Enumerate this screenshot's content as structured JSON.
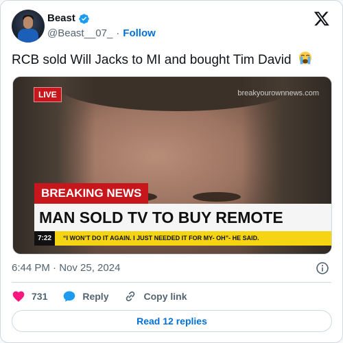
{
  "author": {
    "display_name": "Beast",
    "handle": "@Beast__07_",
    "separator": "·",
    "follow_label": "Follow",
    "verified": true
  },
  "tweet": {
    "text": "RCB sold Will Jacks to MI and bought Tim David",
    "emoji": "loudly-crying-face"
  },
  "media": {
    "live_label": "LIVE",
    "watermark": "breakyourownnews.com",
    "breaking_label": "BREAKING NEWS",
    "headline": "MAN SOLD TV TO BUY REMOTE",
    "ticker_time": "7:22",
    "ticker_quote": "“I WON’T DO IT AGAIN. I JUST NEEDED IT FOR MY- OH”- HE SAID."
  },
  "meta": {
    "timestamp": "6:44 PM · Nov 25, 2024"
  },
  "actions": {
    "likes": "731",
    "reply_label": "Reply",
    "copy_link_label": "Copy link"
  },
  "footer": {
    "read_replies_label": "Read 12 replies"
  },
  "colors": {
    "accent": "#006fd6",
    "like": "#f91880",
    "breaking_red": "#c8161d",
    "ticker_yellow": "#f5d414"
  },
  "icons": [
    "verified-badge-icon",
    "x-logo-icon",
    "info-icon",
    "heart-icon",
    "reply-bubble-icon",
    "link-icon"
  ]
}
